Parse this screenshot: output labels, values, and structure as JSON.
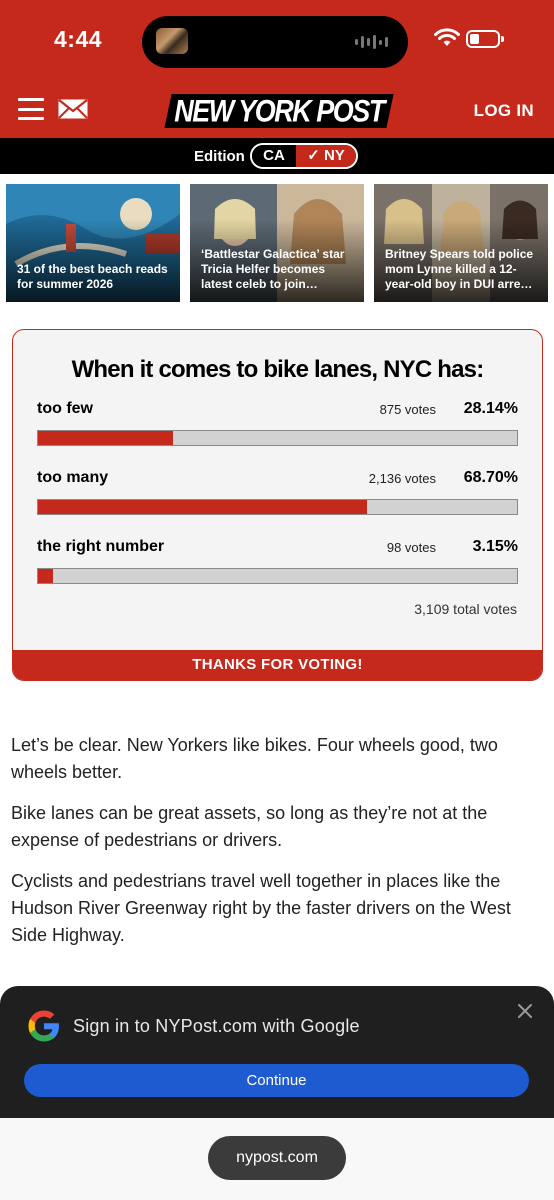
{
  "status_bar": {
    "time": "4:44",
    "battery_level": 0.2,
    "icons": [
      "now-playing-thumb-icon",
      "audio-wave-icon",
      "wifi-icon",
      "battery-icon"
    ]
  },
  "header": {
    "logo_text": "NEW YORK POST",
    "login_label": "LOG IN",
    "brand_color": "#c4291c",
    "icons": [
      "hamburger-menu-icon",
      "mail-icon"
    ]
  },
  "edition": {
    "label": "Edition",
    "options": [
      "CA",
      "✓ NY"
    ],
    "selected": "NY"
  },
  "stories": [
    {
      "caption": "31 of the best beach reads for summer 2026"
    },
    {
      "caption": "‘Battlestar Galactica’ star Tricia Helfer becomes latest celeb to join…"
    },
    {
      "caption": "Britney Spears told police mom Lynne killed a 12-year-old boy in DUI arre…"
    }
  ],
  "poll": {
    "question": "When it comes to bike lanes, NYC has:",
    "options": [
      {
        "label": "too few",
        "votes": "875 votes",
        "percent": "28.14%",
        "share": 0.2814
      },
      {
        "label": "too many",
        "votes": "2,136 votes",
        "percent": "68.70%",
        "share": 0.687
      },
      {
        "label": "the right number",
        "votes": "98 votes",
        "percent": "3.15%",
        "share": 0.0315
      }
    ],
    "total": "3,109 total votes",
    "footer": "THANKS FOR VOTING!"
  },
  "article": {
    "paragraphs": [
      "Let’s be clear. New Yorkers like bikes. Four wheels good, two wheels better.",
      "Bike lanes can be great assets, so long as they’re not at the expense of pedestrians or drivers.",
      "Cyclists and pedestrians travel well together in places like the Hudson River Greenway right by the faster drivers on the West Side Highway."
    ]
  },
  "google_prompt": {
    "text": "Sign in to NYPost.com with Google",
    "button_label": "Continue",
    "button_color": "#1e5bd1",
    "icons": [
      "google-g-icon",
      "close-icon"
    ]
  },
  "browser": {
    "url": "nypost.com"
  }
}
